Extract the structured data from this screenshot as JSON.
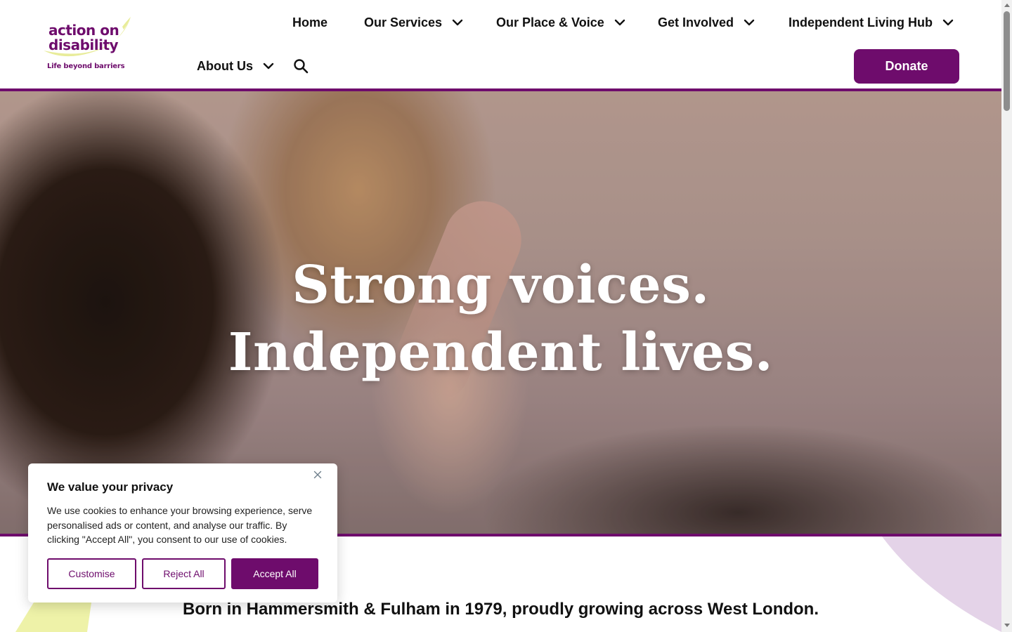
{
  "logo": {
    "line1": "action on",
    "line2": "disability",
    "tagline": "Life beyond barriers"
  },
  "nav": {
    "home": "Home",
    "services": "Our Services",
    "place_voice": "Our Place & Voice",
    "get_involved": "Get Involved",
    "hub": "Independent Living Hub",
    "about": "About Us"
  },
  "donate_label": "Donate",
  "hero": {
    "line1": "Strong voices.",
    "line2": "Independent lives."
  },
  "lead": "Born in Hammersmith & Fulham in 1979, proudly growing across West London.",
  "cookie": {
    "title": "We value your privacy",
    "text": "We use cookies to enhance your browsing experience, serve personalised ads or content, and analyse our traffic. By clicking \"Accept All\", you consent to our use of cookies.",
    "customise": "Customise",
    "reject": "Reject All",
    "accept": "Accept All"
  },
  "colors": {
    "brand_purple": "#6e0c6c",
    "brand_yellow": "#e8ec9a",
    "deco_lilac": "#e4d3e8"
  },
  "icons": {
    "search": "search-icon",
    "chevron": "chevron-down-icon",
    "close": "close-icon"
  }
}
